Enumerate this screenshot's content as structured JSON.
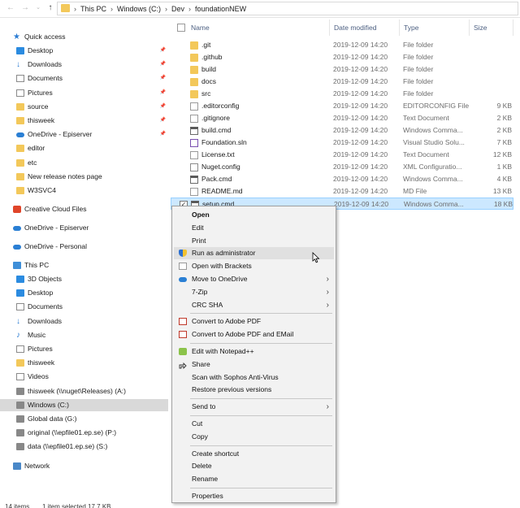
{
  "address_bar": {
    "breadcrumbs": [
      "This PC",
      "Windows (C:)",
      "Dev",
      "foundationNEW"
    ]
  },
  "nav_pane": {
    "quick_access": {
      "label": "Quick access",
      "items": [
        {
          "label": "Desktop",
          "icon": "desktop-icon",
          "pinned": true
        },
        {
          "label": "Downloads",
          "icon": "downloads-icon",
          "pinned": true
        },
        {
          "label": "Documents",
          "icon": "documents-icon",
          "pinned": true
        },
        {
          "label": "Pictures",
          "icon": "pictures-icon",
          "pinned": true
        },
        {
          "label": "source",
          "icon": "folder-icon",
          "pinned": true
        },
        {
          "label": "thisweek",
          "icon": "folder-icon",
          "pinned": true
        },
        {
          "label": "OneDrive - Episerver",
          "icon": "onedrive-icon",
          "pinned": true
        },
        {
          "label": "editor",
          "icon": "folder-icon",
          "pinned": false
        },
        {
          "label": "etc",
          "icon": "folder-icon",
          "pinned": false
        },
        {
          "label": "New release notes page",
          "icon": "folder-icon",
          "pinned": false
        },
        {
          "label": "W3SVC4",
          "icon": "folder-icon",
          "pinned": false
        }
      ]
    },
    "creative_cloud": "Creative Cloud Files",
    "onedrive_episerver": "OneDrive - Episerver",
    "onedrive_personal": "OneDrive - Personal",
    "this_pc": {
      "label": "This PC",
      "items": [
        {
          "label": "3D Objects",
          "icon": "3d-objects-icon"
        },
        {
          "label": "Desktop",
          "icon": "desktop-icon"
        },
        {
          "label": "Documents",
          "icon": "documents-icon"
        },
        {
          "label": "Downloads",
          "icon": "downloads-icon"
        },
        {
          "label": "Music",
          "icon": "music-icon"
        },
        {
          "label": "Pictures",
          "icon": "pictures-icon"
        },
        {
          "label": "thisweek",
          "icon": "folder-icon"
        },
        {
          "label": "Videos",
          "icon": "videos-icon"
        },
        {
          "label": "thisweek (\\\\nuget\\Releases) (A:)",
          "icon": "network-drive-icon"
        },
        {
          "label": "Windows (C:)",
          "icon": "drive-icon",
          "selected": true
        },
        {
          "label": "Global data (G:)",
          "icon": "network-drive-icon"
        },
        {
          "label": "original (\\\\epfile01.ep.se) (P:)",
          "icon": "network-drive-icon"
        },
        {
          "label": "data (\\\\epfile01.ep.se) (S:)",
          "icon": "network-drive-icon"
        }
      ]
    },
    "network": "Network",
    "pin_glyph": "📌"
  },
  "file_list": {
    "columns": {
      "name": "Name",
      "date": "Date modified",
      "type": "Type",
      "size": "Size"
    },
    "rows": [
      {
        "name": ".git",
        "date": "2019-12-09 14:20",
        "type": "File folder",
        "size": "",
        "kind": "folder"
      },
      {
        "name": ".github",
        "date": "2019-12-09 14:20",
        "type": "File folder",
        "size": "",
        "kind": "folder"
      },
      {
        "name": "build",
        "date": "2019-12-09 14:20",
        "type": "File folder",
        "size": "",
        "kind": "folder"
      },
      {
        "name": "docs",
        "date": "2019-12-09 14:20",
        "type": "File folder",
        "size": "",
        "kind": "folder"
      },
      {
        "name": "src",
        "date": "2019-12-09 14:20",
        "type": "File folder",
        "size": "",
        "kind": "folder"
      },
      {
        "name": ".editorconfig",
        "date": "2019-12-09 14:20",
        "type": "EDITORCONFIG File",
        "size": "9 KB",
        "kind": "file"
      },
      {
        "name": ".gitignore",
        "date": "2019-12-09 14:20",
        "type": "Text Document",
        "size": "2 KB",
        "kind": "file"
      },
      {
        "name": "build.cmd",
        "date": "2019-12-09 14:20",
        "type": "Windows Comma...",
        "size": "2 KB",
        "kind": "cmd"
      },
      {
        "name": "Foundation.sln",
        "date": "2019-12-09 14:20",
        "type": "Visual Studio Solu...",
        "size": "7 KB",
        "kind": "sln"
      },
      {
        "name": "License.txt",
        "date": "2019-12-09 14:20",
        "type": "Text Document",
        "size": "12 KB",
        "kind": "file"
      },
      {
        "name": "Nuget.config",
        "date": "2019-12-09 14:20",
        "type": "XML Configuratio...",
        "size": "1 KB",
        "kind": "cfg"
      },
      {
        "name": "Pack.cmd",
        "date": "2019-12-09 14:20",
        "type": "Windows Comma...",
        "size": "4 KB",
        "kind": "cmd"
      },
      {
        "name": "README.md",
        "date": "2019-12-09 14:20",
        "type": "MD File",
        "size": "13 KB",
        "kind": "file"
      },
      {
        "name": "setup.cmd",
        "date": "2019-12-09 14:20",
        "type": "Windows Comma...",
        "size": "18 KB",
        "kind": "cmd",
        "selected": true
      }
    ]
  },
  "context_menu": {
    "items": [
      {
        "label": "Open",
        "bold": true
      },
      {
        "label": "Edit"
      },
      {
        "label": "Print"
      },
      {
        "label": "Run as administrator",
        "icon": "uac-shield-icon",
        "hover": true
      },
      {
        "label": "Open with Brackets",
        "icon": "brackets-icon"
      },
      {
        "label": "Move to OneDrive",
        "icon": "onedrive-icon",
        "submenu": true
      },
      {
        "label": "7-Zip",
        "submenu": true
      },
      {
        "label": "CRC SHA",
        "submenu": true
      },
      {
        "sep": true
      },
      {
        "label": "Convert to Adobe PDF",
        "icon": "pdf-icon"
      },
      {
        "label": "Convert to Adobe PDF and EMail",
        "icon": "pdf-icon"
      },
      {
        "sep": true
      },
      {
        "label": "Edit with Notepad++",
        "icon": "notepadpp-icon"
      },
      {
        "label": "Share",
        "icon": "share-icon"
      },
      {
        "label": "Scan with Sophos Anti-Virus"
      },
      {
        "label": "Restore previous versions"
      },
      {
        "sep": true
      },
      {
        "label": "Send to",
        "submenu": true
      },
      {
        "sep": true
      },
      {
        "label": "Cut"
      },
      {
        "label": "Copy"
      },
      {
        "sep": true
      },
      {
        "label": "Create shortcut"
      },
      {
        "label": "Delete"
      },
      {
        "label": "Rename"
      },
      {
        "sep": true
      },
      {
        "label": "Properties"
      }
    ],
    "submenu_glyph": "›"
  },
  "status_bar": {
    "item_count": "14 items",
    "selection": "1 item selected  17.7 KB"
  },
  "colors": {
    "selection_bg": "#cce8ff",
    "selection_border": "#99d1ff",
    "folder": "#f3c85a",
    "accent_blue": "#2b7cd3"
  }
}
